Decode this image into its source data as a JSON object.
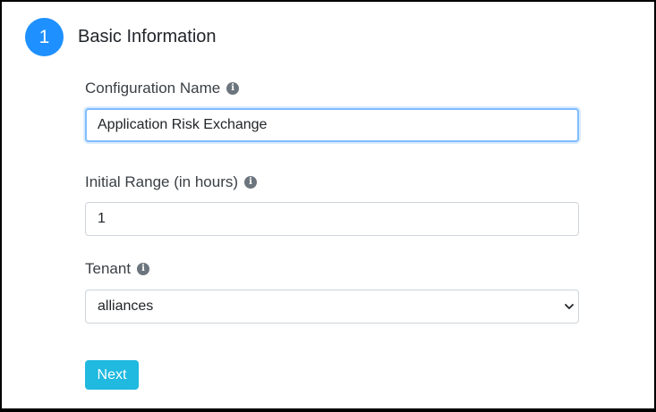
{
  "step": {
    "number": "1",
    "title": "Basic Information"
  },
  "fields": {
    "config_name": {
      "label": "Configuration Name",
      "value": "Application Risk Exchange",
      "info_icon": "info-icon"
    },
    "initial_range": {
      "label": "Initial Range (in hours)",
      "value": "1",
      "info_icon": "info-icon"
    },
    "tenant": {
      "label": "Tenant",
      "selected": "alliances",
      "info_icon": "info-icon"
    }
  },
  "actions": {
    "next_label": "Next"
  },
  "colors": {
    "step_circle": "#1e90ff",
    "next_button": "#20b9e0",
    "focus_border": "#80bdff"
  }
}
